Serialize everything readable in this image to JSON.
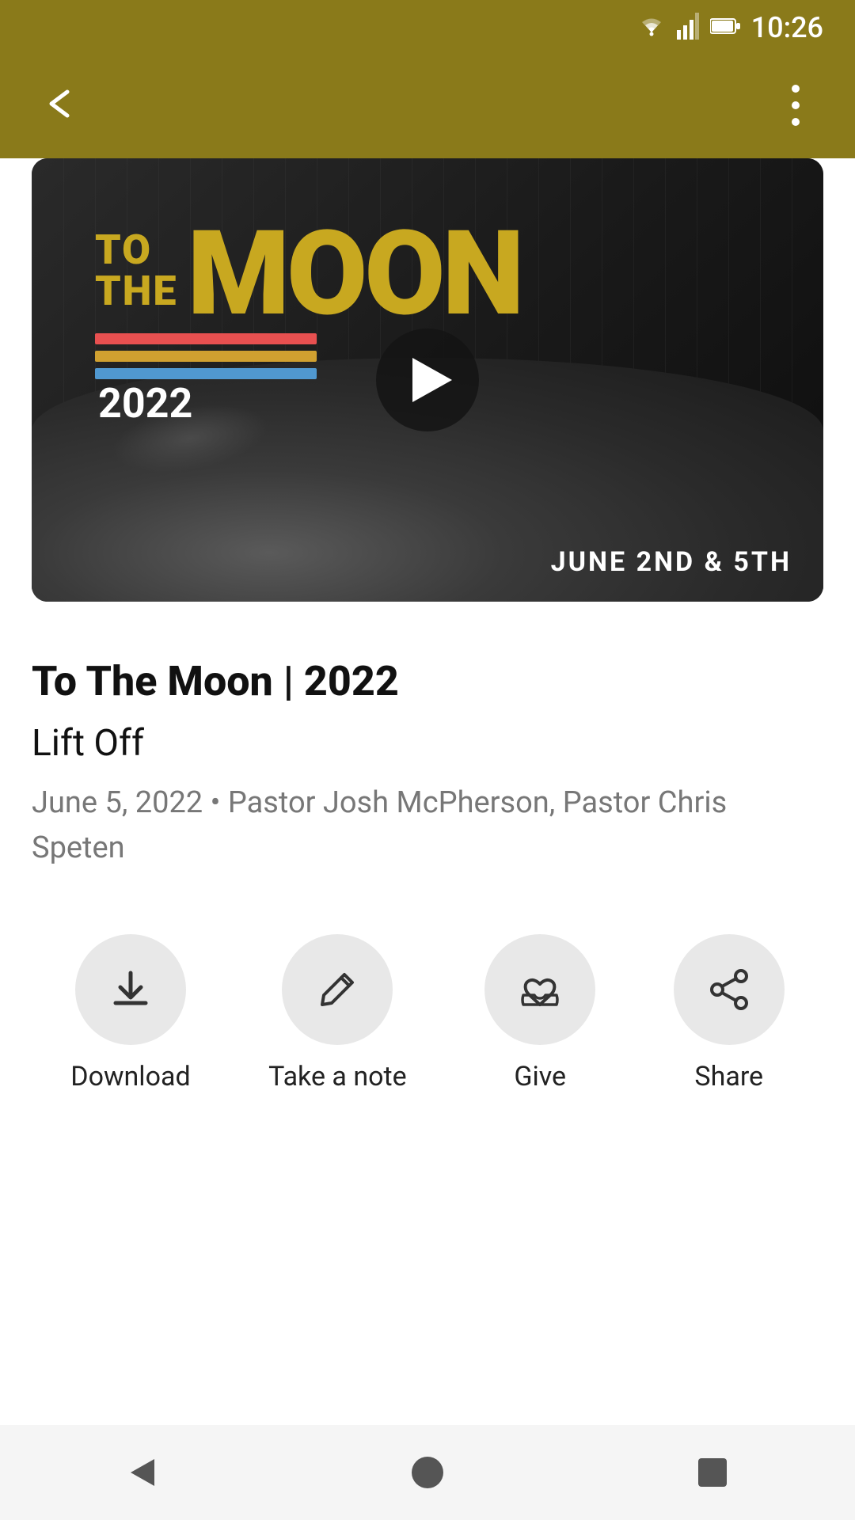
{
  "status_bar": {
    "time": "10:26"
  },
  "top_bar": {
    "back_label": "←",
    "more_label": "⋮"
  },
  "video": {
    "title_line1": "TO",
    "title_line2": "THE",
    "title_moon": "MOON",
    "title_year": "2022",
    "date_text": "JUNE 2ND & 5TH",
    "rainbow_colors": [
      "#e05050",
      "#e09030",
      "#50a050",
      "#5090d0"
    ]
  },
  "content": {
    "series_title": "To The Moon | 2022",
    "sermon_title": "Lift Off",
    "meta": "June 5, 2022 • Pastor Josh McPherson, Pastor Chris Speten"
  },
  "actions": [
    {
      "id": "download",
      "label": "Download"
    },
    {
      "id": "take-a-note",
      "label": "Take a note"
    },
    {
      "id": "give",
      "label": "Give"
    },
    {
      "id": "share",
      "label": "Share"
    }
  ],
  "bottom_nav": {
    "back_label": "◄",
    "home_label": "●",
    "square_label": "■"
  }
}
